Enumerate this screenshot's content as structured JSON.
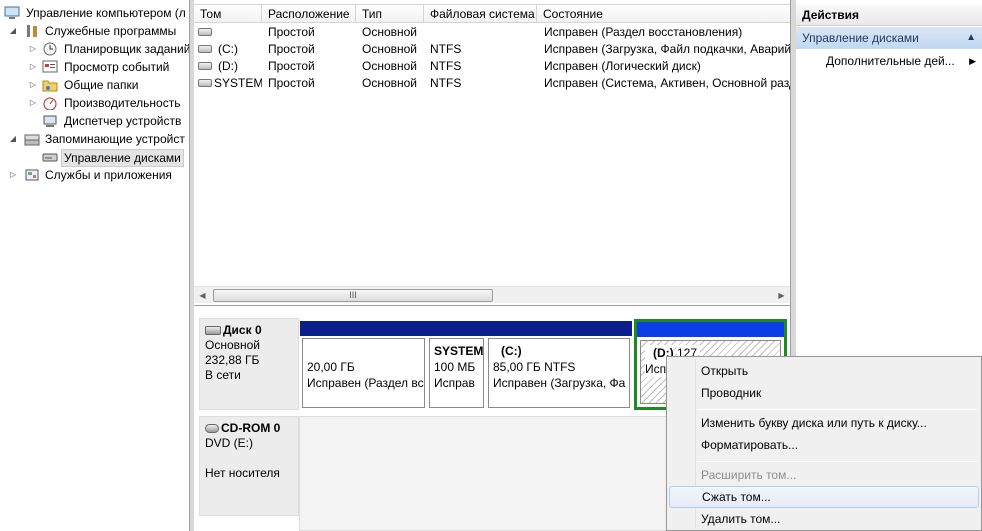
{
  "tree": {
    "root": "Управление компьютером (л",
    "system_tools": "Служебные программы",
    "scheduler": "Планировщик заданий",
    "event_viewer": "Просмотр событий",
    "shared_folders": "Общие папки",
    "performance": "Производительность",
    "device_manager": "Диспетчер устройств",
    "storage": "Запоминающие устройст",
    "disk_mgmt": "Управление дисками",
    "services": "Службы и приложения"
  },
  "list": {
    "columns": [
      "Том",
      "Расположение",
      "Тип",
      "Файловая система",
      "Состояние"
    ],
    "rows": [
      {
        "vol": "",
        "loc": "Простой",
        "type": "Основной",
        "fs": "",
        "status": "Исправен (Раздел восстановления)"
      },
      {
        "vol": "(C:)",
        "loc": "Простой",
        "type": "Основной",
        "fs": "NTFS",
        "status": "Исправен (Загрузка, Файл подкачки, Аварий"
      },
      {
        "vol": "(D:)",
        "loc": "Простой",
        "type": "Основной",
        "fs": "NTFS",
        "status": "Исправен (Логический диск)"
      },
      {
        "vol": "SYSTEM",
        "loc": "Простой",
        "type": "Основной",
        "fs": "NTFS",
        "status": "Исправен (Система, Активен, Основной разд"
      }
    ],
    "scroll_thumb": "III"
  },
  "disk0": {
    "name": "Диск 0",
    "kind": "Основной",
    "size": "232,88 ГБ",
    "state": "В сети",
    "partitions": [
      {
        "title": "",
        "size": "20,00 ГБ",
        "status": "Исправен (Раздел вс"
      },
      {
        "title": "SYSTEM",
        "size": "100 МБ",
        "status": "Исправ"
      },
      {
        "title": "(C:)",
        "size": "85,00 ГБ NTFS",
        "status": "Исправен (Загрузка, Фа"
      },
      {
        "title": "(D:)",
        "size": "127,",
        "status": "Исп"
      }
    ]
  },
  "cdrom": {
    "name": "CD-ROM 0",
    "drive": "DVD (E:)",
    "media": "Нет носителя"
  },
  "actions": {
    "title": "Действия",
    "section": "Управление дисками",
    "more": "Дополнительные дей..."
  },
  "menu": {
    "open": "Открыть",
    "explorer": "Проводник",
    "change_letter": "Изменить букву диска или путь к диску...",
    "format": "Форматировать...",
    "extend": "Расширить том...",
    "shrink": "Сжать том...",
    "delete": "Удалить том..."
  },
  "colors": {
    "partition_bar": "#0a1f8a",
    "selected_partition_border": "#1f8a1f",
    "menu_highlight": "#e3ecf8"
  }
}
